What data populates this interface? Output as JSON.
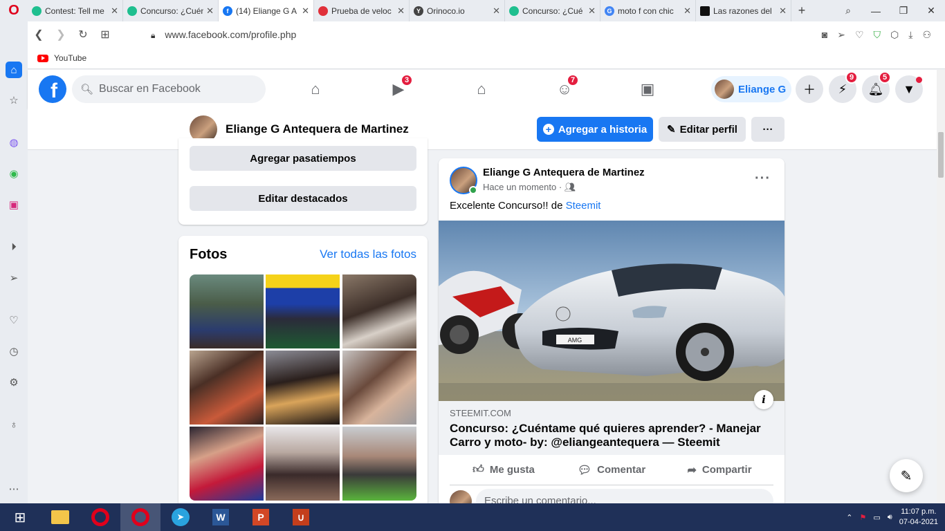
{
  "browser": {
    "tabs": [
      {
        "title": "Contest: Tell me",
        "favicon_color": "#1fbf8f"
      },
      {
        "title": "Concurso: ¿Cuénta",
        "favicon_color": "#1fbf8f"
      },
      {
        "title": "(14) Eliange G A",
        "favicon_color": "#1877f2",
        "active": true
      },
      {
        "title": "Prueba de veloc",
        "favicon_color": "#e0303a"
      },
      {
        "title": "Orinoco.io",
        "favicon_color": "#444444"
      },
      {
        "title": "Concurso: ¿Cué",
        "favicon_color": "#1fbf8f"
      },
      {
        "title": "moto f con chic",
        "favicon_color": "#4285f4"
      },
      {
        "title": "Las razones del",
        "favicon_color": "#111111"
      }
    ],
    "url": "www.facebook.com/profile.php",
    "bookmarks": [
      {
        "label": "YouTube"
      }
    ]
  },
  "facebook": {
    "search_placeholder": "Buscar en Facebook",
    "nav_badges": {
      "watch": "3",
      "groups": "7"
    },
    "profile_pill_name": "Eliange G",
    "header_badges": {
      "messenger": "9",
      "notifications": "5"
    },
    "profile_name": "Eliange G Antequera de Martinez",
    "add_story_label": "Agregar a historia",
    "edit_profile_label": "Editar perfil",
    "more_label": "···"
  },
  "left": {
    "add_hobbies_label": "Agregar pasatiempos",
    "edit_featured_label": "Editar destacados",
    "photos_title": "Fotos",
    "see_all_photos_label": "Ver todas las fotos"
  },
  "post": {
    "author": "Eliange G Antequera de Martinez",
    "time": "Hace un momento ·",
    "text_prefix": "Excelente Concurso!! de ",
    "text_link": "Steemit",
    "link_domain": "STEEMIT.COM",
    "link_title": "Concurso: ¿Cuéntame qué quieres aprender? - Manejar Carro y moto- by: @eliangeantequera — Steemit",
    "like_label": "Me gusta",
    "comment_label": "Comentar",
    "share_label": "Compartir",
    "comment_placeholder": "Escribe un comentario..."
  },
  "taskbar": {
    "time": "11:07 p.m.",
    "date": "07-04-2021"
  }
}
